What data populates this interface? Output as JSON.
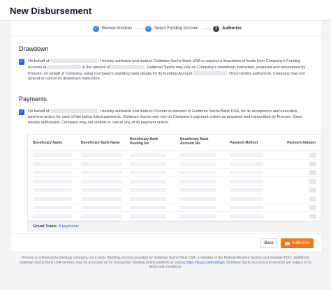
{
  "page": {
    "title": "New Disbursement"
  },
  "steps": [
    {
      "label": "Review Invoices",
      "status": "complete",
      "icon": "check-icon"
    },
    {
      "label": "Select Funding Account",
      "status": "complete",
      "icon": "check-icon"
    },
    {
      "label": "Authorize",
      "status": "active",
      "number": "3"
    }
  ],
  "drawdown": {
    "title": "Drawdown",
    "text_1": "On behalf of",
    "text_2": ", I hereby authorize and instruct Goldman Sachs Bank USA to request a drawdown of funds from Company's Funding",
    "text_3": "Account at",
    "text_4": "in the amount of",
    "text_5": ". Goldman Sachs may rely on Company's drawdown instruction, prepared and transmitted",
    "text_6": "by Procore, on behalf of Company, using Company's standing bank details for its Funding Account",
    "text_7": ". Once hereby authorized, Company may not amend or",
    "text_8": "cancel its drawdown instruction.",
    "checked": true
  },
  "payments": {
    "title": "Payments",
    "text_1": "On behalf of",
    "text_2": ", I hereby authorize and instruct Procore to transmit to Goldman Sachs Bank USA, for its acceptance and execution,",
    "text_3": "payment orders for each of the below listed payments. Goldman Sachs may rely on Company's payment orders as prepared and transmitted by Procore.",
    "text_4": "Once hereby authorized, Company may not amend or cancel any of its payment orders.",
    "checked": true
  },
  "table": {
    "columns": [
      "Beneficiary Name",
      "Beneficiary Bank Name",
      "Beneficiary Bank Routing No.",
      "Beneficiary Bank Account No.",
      "Payment Method",
      "Payment Amount"
    ],
    "row_count": 8,
    "totals_label": "Grand Totals",
    "totals_count": "8 payments"
  },
  "actions": {
    "back_label": "Back",
    "authorize_label": "Authorize"
  },
  "disclaimer": {
    "text_1": "Procore is a financial technology company, not a bank. Banking services provided by Goldman Sachs Bank USA, a member of the Federal Reserve System and member FDIC. Additional Goldman Sachs Bank USA services may be accessed on its Transaction Banking online platform by visiting",
    "link": "https://tb.gs.com/cx/login",
    "text_2": ". Goldman Sachs account and services are subject to its terms and conditions."
  },
  "colors": {
    "accent": "#2563eb",
    "step_complete": "#3b82f6",
    "authorize_button": "#f97316"
  }
}
